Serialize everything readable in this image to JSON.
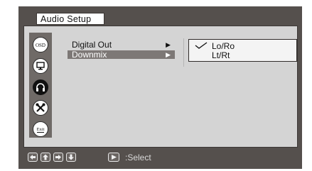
{
  "window": {
    "title": "Audio Setup"
  },
  "sidebar": {
    "items": [
      {
        "icon": "osd-icon",
        "glyph": "OSD"
      },
      {
        "icon": "monitor-icon"
      },
      {
        "icon": "headphones-icon"
      },
      {
        "icon": "tools-icon"
      },
      {
        "icon": "exit-icon",
        "glyph": "Exit"
      }
    ],
    "active_index": 2
  },
  "menu": {
    "items": [
      {
        "label": "Digital Out",
        "arrow": "▶"
      },
      {
        "label": "Downmix",
        "arrow": "▶"
      }
    ],
    "selected_index": 1
  },
  "options": {
    "items": [
      {
        "label": "Lo/Ro",
        "checked": true
      },
      {
        "label": "Lt/Rt",
        "checked": false
      }
    ]
  },
  "footer": {
    "keys": [
      "left-arrow-key-icon",
      "up-arrow-key-icon",
      "right-arrow-key-icon",
      "down-arrow-key-icon"
    ],
    "enter_key": "play-key-icon",
    "hint": ":Select"
  },
  "colors": {
    "frame": "#55504d",
    "panel": "#d4d4d4",
    "icon_column": "#6f6a67",
    "selected_row": "#7d7876"
  }
}
